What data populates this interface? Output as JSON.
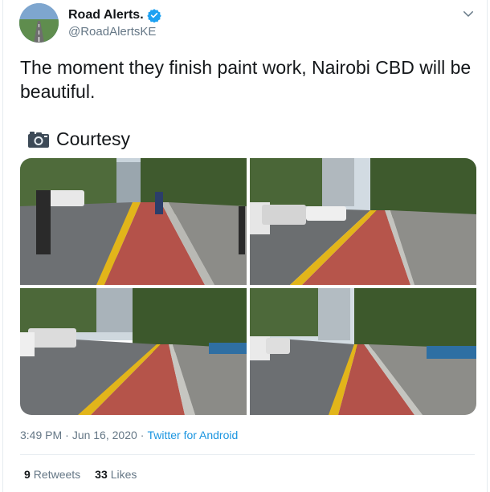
{
  "author": {
    "name": "Road Alerts.",
    "handle": "@RoadAlertsKE",
    "verified_icon": "verified-badge-icon",
    "accent": "#1da1f2"
  },
  "tweet": {
    "text": "The moment they finish paint work, Nairobi CBD will be beautiful.",
    "courtesy_icon": "camera-icon",
    "courtesy_label": "Courtesy",
    "photo_count": 4
  },
  "meta": {
    "time": "3:49 PM",
    "separator1": "·",
    "date": "Jun 16, 2020",
    "separator2": "·",
    "source": "Twitter for Android"
  },
  "stats": {
    "retweets_count": "9",
    "retweets_label": "Retweets",
    "likes_count": "33",
    "likes_label": "Likes"
  },
  "menu_icon": "chevron-down-icon"
}
